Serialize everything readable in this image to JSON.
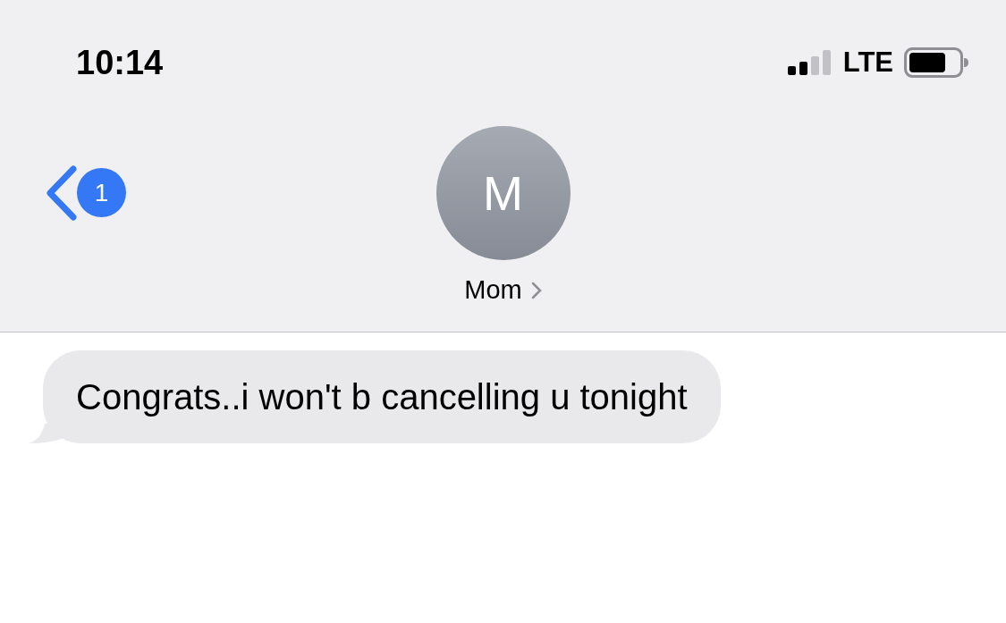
{
  "status_bar": {
    "time": "10:14",
    "network": "LTE"
  },
  "header": {
    "back_badge": "1",
    "avatar_initial": "M",
    "contact_name": "Mom"
  },
  "messages": [
    {
      "kind": "incoming",
      "text": "Congrats..i won't b cancelling u tonight"
    }
  ]
}
